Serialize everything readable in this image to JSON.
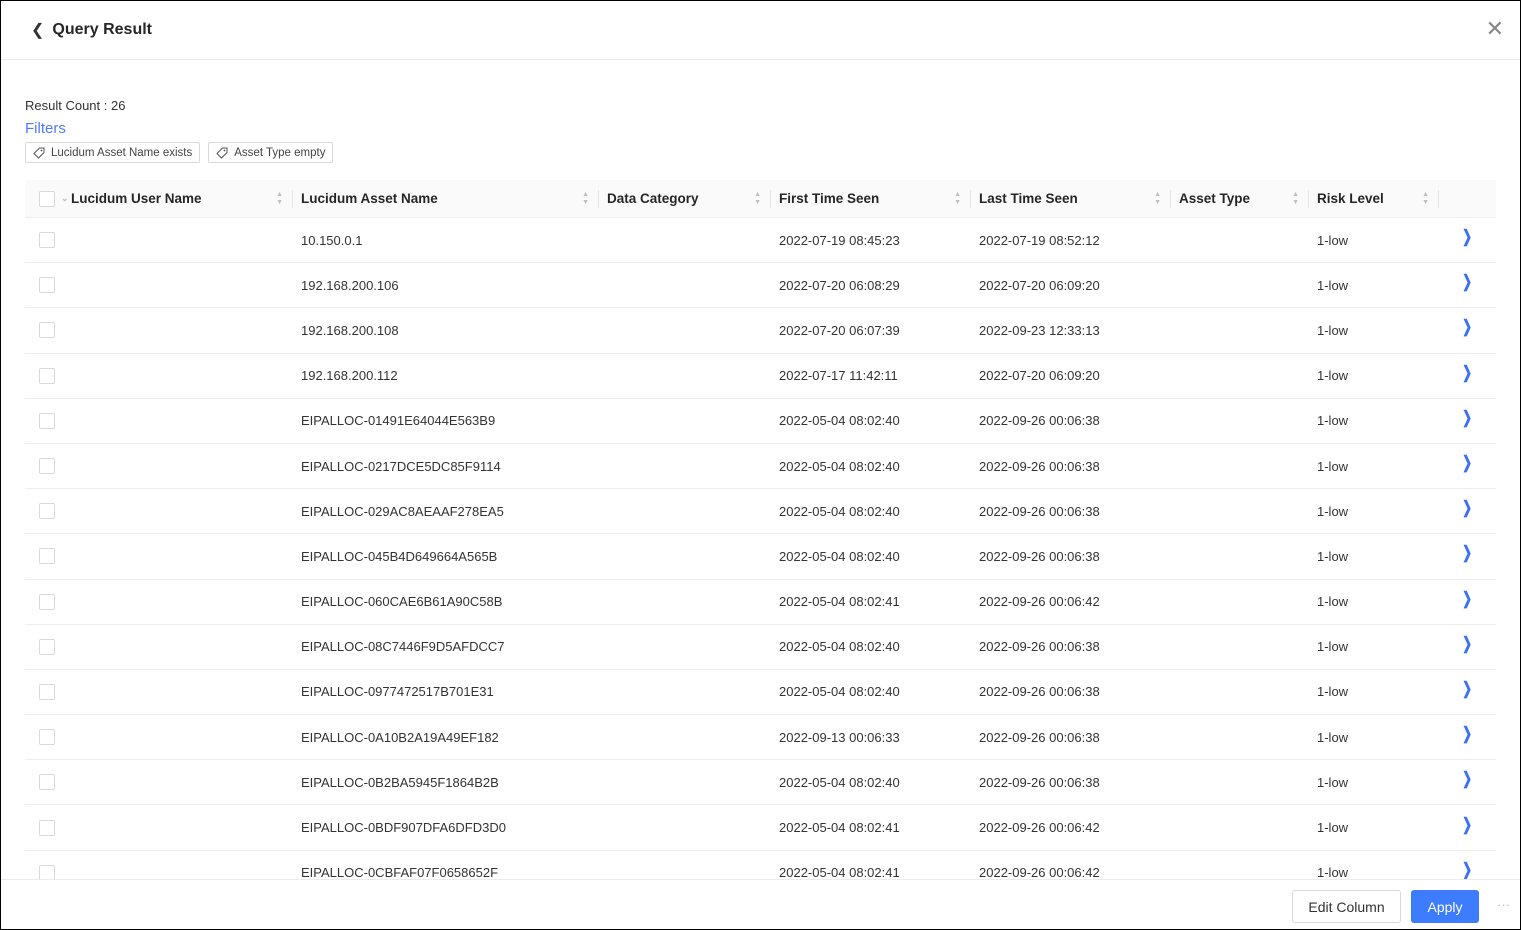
{
  "header": {
    "title": "Query Result",
    "back_icon": "chevron-left-icon",
    "close_icon": "close-icon"
  },
  "summary": {
    "result_count": "Result Count : 26",
    "filters_label": "Filters"
  },
  "filters": [
    {
      "label": "Lucidum Asset Name exists",
      "icon": "tag-icon"
    },
    {
      "label": "Asset Type empty",
      "icon": "tag-icon"
    }
  ],
  "table": {
    "columns": [
      "Lucidum User Name",
      "Lucidum Asset Name",
      "Data Category",
      "First Time Seen",
      "Last Time Seen",
      "Asset Type",
      "Risk Level"
    ],
    "rows": [
      {
        "user": "",
        "asset": "10.150.0.1",
        "category": "",
        "first": "2022-07-19 08:45:23",
        "last": "2022-07-19 08:52:12",
        "type": "",
        "risk": "1-low"
      },
      {
        "user": "",
        "asset": "192.168.200.106",
        "category": "",
        "first": "2022-07-20 06:08:29",
        "last": "2022-07-20 06:09:20",
        "type": "",
        "risk": "1-low"
      },
      {
        "user": "",
        "asset": "192.168.200.108",
        "category": "",
        "first": "2022-07-20 06:07:39",
        "last": "2022-09-23 12:33:13",
        "type": "",
        "risk": "1-low"
      },
      {
        "user": "",
        "asset": "192.168.200.112",
        "category": "",
        "first": "2022-07-17 11:42:11",
        "last": "2022-07-20 06:09:20",
        "type": "",
        "risk": "1-low"
      },
      {
        "user": "",
        "asset": "EIPALLOC-01491E64044E563B9",
        "category": "",
        "first": "2022-05-04 08:02:40",
        "last": "2022-09-26 00:06:38",
        "type": "",
        "risk": "1-low"
      },
      {
        "user": "",
        "asset": "EIPALLOC-0217DCE5DC85F9114",
        "category": "",
        "first": "2022-05-04 08:02:40",
        "last": "2022-09-26 00:06:38",
        "type": "",
        "risk": "1-low"
      },
      {
        "user": "",
        "asset": "EIPALLOC-029AC8AEAAF278EA5",
        "category": "",
        "first": "2022-05-04 08:02:40",
        "last": "2022-09-26 00:06:38",
        "type": "",
        "risk": "1-low"
      },
      {
        "user": "",
        "asset": "EIPALLOC-045B4D649664A565B",
        "category": "",
        "first": "2022-05-04 08:02:40",
        "last": "2022-09-26 00:06:38",
        "type": "",
        "risk": "1-low"
      },
      {
        "user": "",
        "asset": "EIPALLOC-060CAE6B61A90C58B",
        "category": "",
        "first": "2022-05-04 08:02:41",
        "last": "2022-09-26 00:06:42",
        "type": "",
        "risk": "1-low"
      },
      {
        "user": "",
        "asset": "EIPALLOC-08C7446F9D5AFDCC7",
        "category": "",
        "first": "2022-05-04 08:02:40",
        "last": "2022-09-26 00:06:38",
        "type": "",
        "risk": "1-low"
      },
      {
        "user": "",
        "asset": "EIPALLOC-0977472517B701E31",
        "category": "",
        "first": "2022-05-04 08:02:40",
        "last": "2022-09-26 00:06:38",
        "type": "",
        "risk": "1-low"
      },
      {
        "user": "",
        "asset": "EIPALLOC-0A10B2A19A49EF182",
        "category": "",
        "first": "2022-09-13 00:06:33",
        "last": "2022-09-26 00:06:38",
        "type": "",
        "risk": "1-low"
      },
      {
        "user": "",
        "asset": "EIPALLOC-0B2BA5945F1864B2B",
        "category": "",
        "first": "2022-05-04 08:02:40",
        "last": "2022-09-26 00:06:38",
        "type": "",
        "risk": "1-low"
      },
      {
        "user": "",
        "asset": "EIPALLOC-0BDF907DFA6DFD3D0",
        "category": "",
        "first": "2022-05-04 08:02:41",
        "last": "2022-09-26 00:06:42",
        "type": "",
        "risk": "1-low"
      },
      {
        "user": "",
        "asset": "EIPALLOC-0CBFAF07F0658652F",
        "category": "",
        "first": "2022-05-04 08:02:41",
        "last": "2022-09-26 00:06:42",
        "type": "",
        "risk": "1-low"
      }
    ]
  },
  "footer": {
    "edit_column": "Edit Column",
    "apply": "Apply",
    "more": "···"
  },
  "colors": {
    "accent": "#3d7bff",
    "link": "#4f7cff"
  }
}
